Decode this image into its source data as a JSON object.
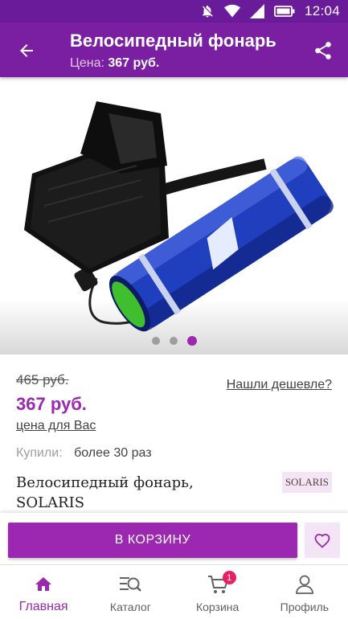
{
  "status_bar": {
    "time": "12:04"
  },
  "header": {
    "title": "Велосипедный фонарь",
    "price_label": "Цена:",
    "price_value": "367 руб."
  },
  "gallery": {
    "slides": 3,
    "active_slide": 3
  },
  "product": {
    "old_price": "465 руб.",
    "price": "367 руб.",
    "price_note": "цена для Вас",
    "cheaper_link": "Нашли дешевле?",
    "bought_label": "Купили:",
    "bought_value": "более 30 раз",
    "name": "Велосипедный фонарь, SOLARIS",
    "brand": "SOLARIS"
  },
  "actions": {
    "add_to_cart": "В КОРЗИНУ"
  },
  "bottom_nav": {
    "items": [
      {
        "label": "Главная",
        "icon": "home-icon",
        "active": true
      },
      {
        "label": "Каталог",
        "icon": "catalog-search-icon",
        "active": false
      },
      {
        "label": "Корзина",
        "icon": "cart-icon",
        "active": false,
        "badge": "1"
      },
      {
        "label": "Профиль",
        "icon": "profile-icon",
        "active": false
      }
    ]
  },
  "colors": {
    "app_bar": "#7b1fa2",
    "status_bar": "#6a1b9a",
    "accent": "#9c27b0",
    "badge": "#e91e63"
  }
}
